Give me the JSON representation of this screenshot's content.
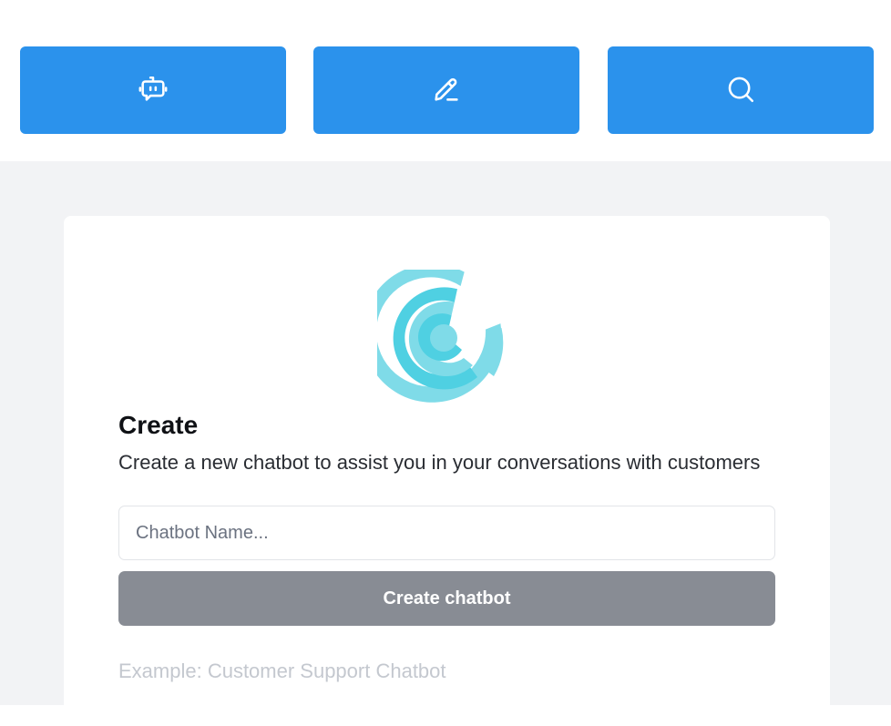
{
  "nav": {
    "buttons": [
      {
        "icon": "chatbot-icon"
      },
      {
        "icon": "edit-icon"
      },
      {
        "icon": "search-icon"
      }
    ],
    "accent_color": "#2b92ec"
  },
  "card": {
    "logo": "spiral-logo",
    "title": "Create",
    "subtitle": "Create a new chatbot to assist you in your conversations with customers",
    "name_input": {
      "placeholder": "Chatbot Name...",
      "value": ""
    },
    "create_button_label": "Create chatbot",
    "example_text": "Example: Customer Support Chatbot"
  },
  "colors": {
    "background": "#f2f3f5",
    "button_disabled": "#888c94",
    "logo_light": "#7fdbe8",
    "logo_dark": "#4fd0e2"
  }
}
